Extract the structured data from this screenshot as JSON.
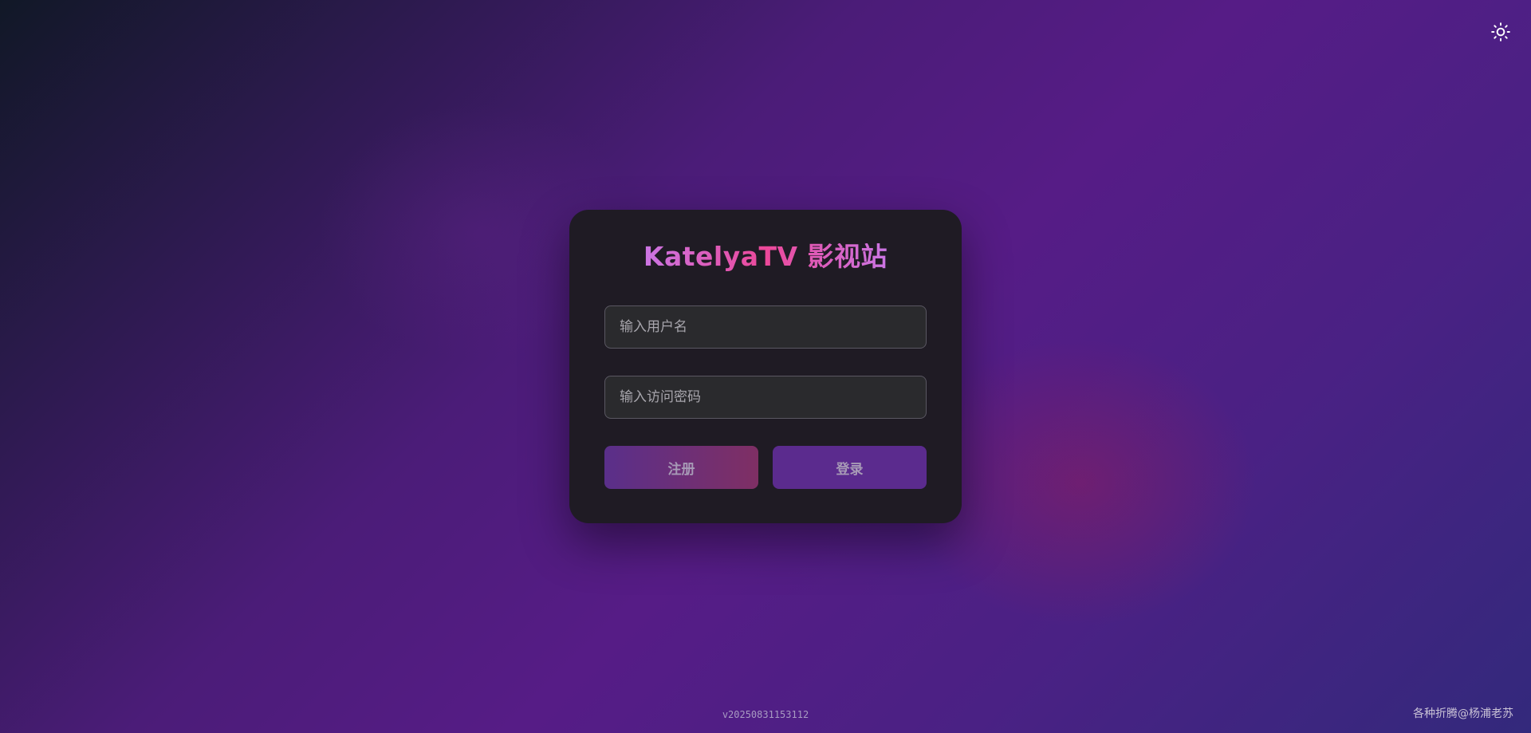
{
  "theme_toggle": {
    "icon": "sun-icon",
    "color": "#ffffff"
  },
  "login": {
    "title": "KatelyaTV 影视站",
    "username_placeholder": "输入用户名",
    "password_placeholder": "输入访问密码",
    "register_label": "注册",
    "login_label": "登录"
  },
  "footer": {
    "version": "v20250831153112",
    "credit": "各种折腾@杨浦老苏"
  },
  "colors": {
    "title_gradient": [
      "#c084fc",
      "#ec4899"
    ],
    "card_background": "#1f1b24",
    "login_button": "#5b2b8e",
    "register_button_gradient": [
      "#5a2f8a",
      "#7f2f64"
    ]
  }
}
